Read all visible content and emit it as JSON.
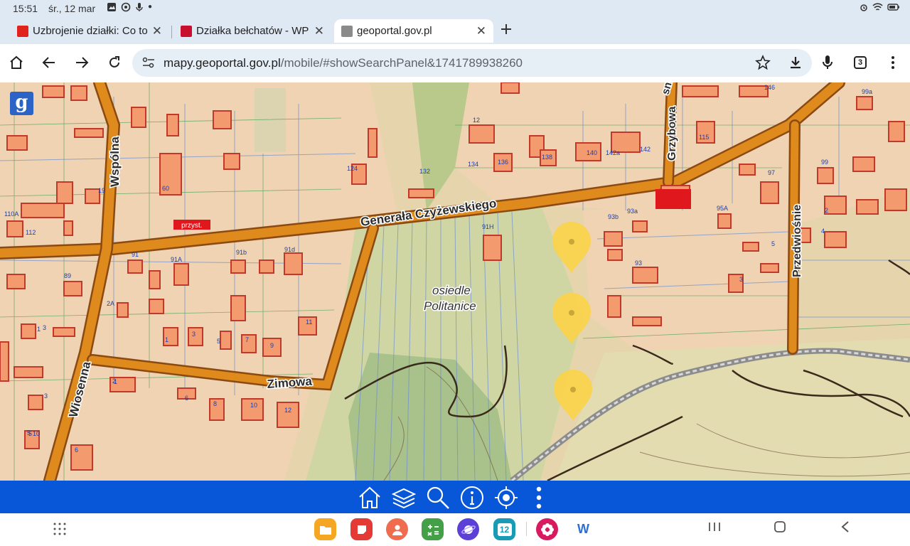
{
  "status_bar": {
    "time": "15:51",
    "date": "śr., 12 mar",
    "icons": [
      "gallery-icon",
      "location-icon",
      "mic-icon",
      "dot-icon"
    ],
    "right_icons": [
      "alarm-icon",
      "wifi-icon",
      "battery-icon"
    ]
  },
  "tabs": [
    {
      "title": "Uzbrojenie działki: Co to",
      "favicon_color": "#e0231d",
      "active": false
    },
    {
      "title": "Działka bełchatów - WP",
      "favicon_color": "#c8102e",
      "active": false
    },
    {
      "title": "geoportal.gov.pl",
      "favicon_color": "#8a8a8a",
      "active": true
    }
  ],
  "address_bar": {
    "url_domain": "mapy.geoportal.gov.pl",
    "url_path": "/mobile/#showSearchPanel&1741789938260",
    "tab_count": "3"
  },
  "map": {
    "logo_letter": "g",
    "streets": [
      "Generała Czyżewskiego",
      "Wspólna",
      "Zimowa",
      "Wiosenna",
      "Grzybowa",
      "Przedwiośnie"
    ],
    "street_fragment_top": "sna",
    "settlement_line1": "osiedle",
    "settlement_line2": "Politanice",
    "bus_stop_label": "przyst.",
    "house_numbers": [
      "146",
      "99a",
      "115",
      "142a",
      "142",
      "140",
      "138",
      "136",
      "134",
      "132",
      "124",
      "60",
      "12",
      "91H",
      "91b",
      "91d",
      "91A",
      "91",
      "89",
      "110A",
      "112",
      "97",
      "99",
      "95A",
      "93b",
      "93a",
      "93",
      "11",
      "9",
      "7",
      "5",
      "3",
      "1",
      "2A",
      "2",
      "6",
      "8",
      "10",
      "12",
      "1",
      "3",
      "5",
      "19",
      "10",
      "6",
      "3",
      "5",
      "1",
      "2",
      "4",
      "5",
      "3"
    ],
    "pins": 3
  },
  "map_toolbar": {
    "buttons": [
      "home-icon",
      "layers-icon",
      "search-icon",
      "info-icon",
      "locate-icon",
      "more-icon"
    ]
  },
  "nav_bar": {
    "apps": [
      {
        "name": "app-files",
        "color": "#f5a623"
      },
      {
        "name": "app-notes",
        "color": "#e53935"
      },
      {
        "name": "app-contacts",
        "color": "#ef6c4f"
      },
      {
        "name": "app-calculator",
        "color": "#43a047"
      },
      {
        "name": "app-internet",
        "color": "#5b3fd6"
      },
      {
        "name": "app-calendar",
        "color": "#1a9bb5"
      },
      {
        "name": "app-blossom",
        "color": "#d81b60"
      },
      {
        "name": "app-word",
        "color": "#ffffff"
      }
    ],
    "calendar_day": "12",
    "word_letter": "W"
  }
}
